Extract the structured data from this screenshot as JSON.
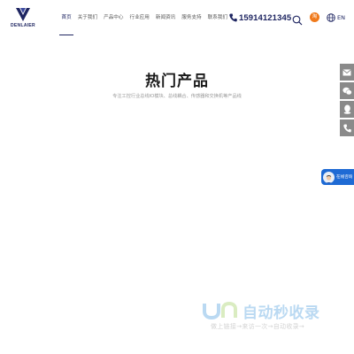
{
  "header": {
    "logo_text": "DENLAIER",
    "nav": [
      {
        "label": "首页",
        "active": true
      },
      {
        "label": "关于我们",
        "active": false
      },
      {
        "label": "产品中心",
        "active": false
      },
      {
        "label": "行业应用",
        "active": false
      },
      {
        "label": "新闻资讯",
        "active": false
      },
      {
        "label": "服务支持",
        "active": false
      },
      {
        "label": "联系我们",
        "active": false
      }
    ],
    "phone": "15914121345",
    "shop_badge": "淘",
    "language": "EN",
    "icons": {
      "logo": "logo-icon",
      "phone": "phone-icon",
      "search": "search-icon",
      "language": "globe-icon"
    }
  },
  "main": {
    "title": "热门产品",
    "subtitle": "专注工控行业总线IO模块、总线耦合、传感器和交换机等产品线"
  },
  "side_toolbar": {
    "icons": [
      "mail-icon",
      "wechat-icon",
      "qq-icon",
      "phone-icon"
    ]
  },
  "consult": {
    "label": "在线咨询"
  },
  "watermark": {
    "title": "自动秒收录",
    "subtitle": "做上链接→来访一次→自动收录→"
  },
  "colors": {
    "brand": "#1e2561",
    "accent_orange": "#f07a1c",
    "consult_blue": "#1e6ad4",
    "side_gray": "#8a8a8a"
  }
}
